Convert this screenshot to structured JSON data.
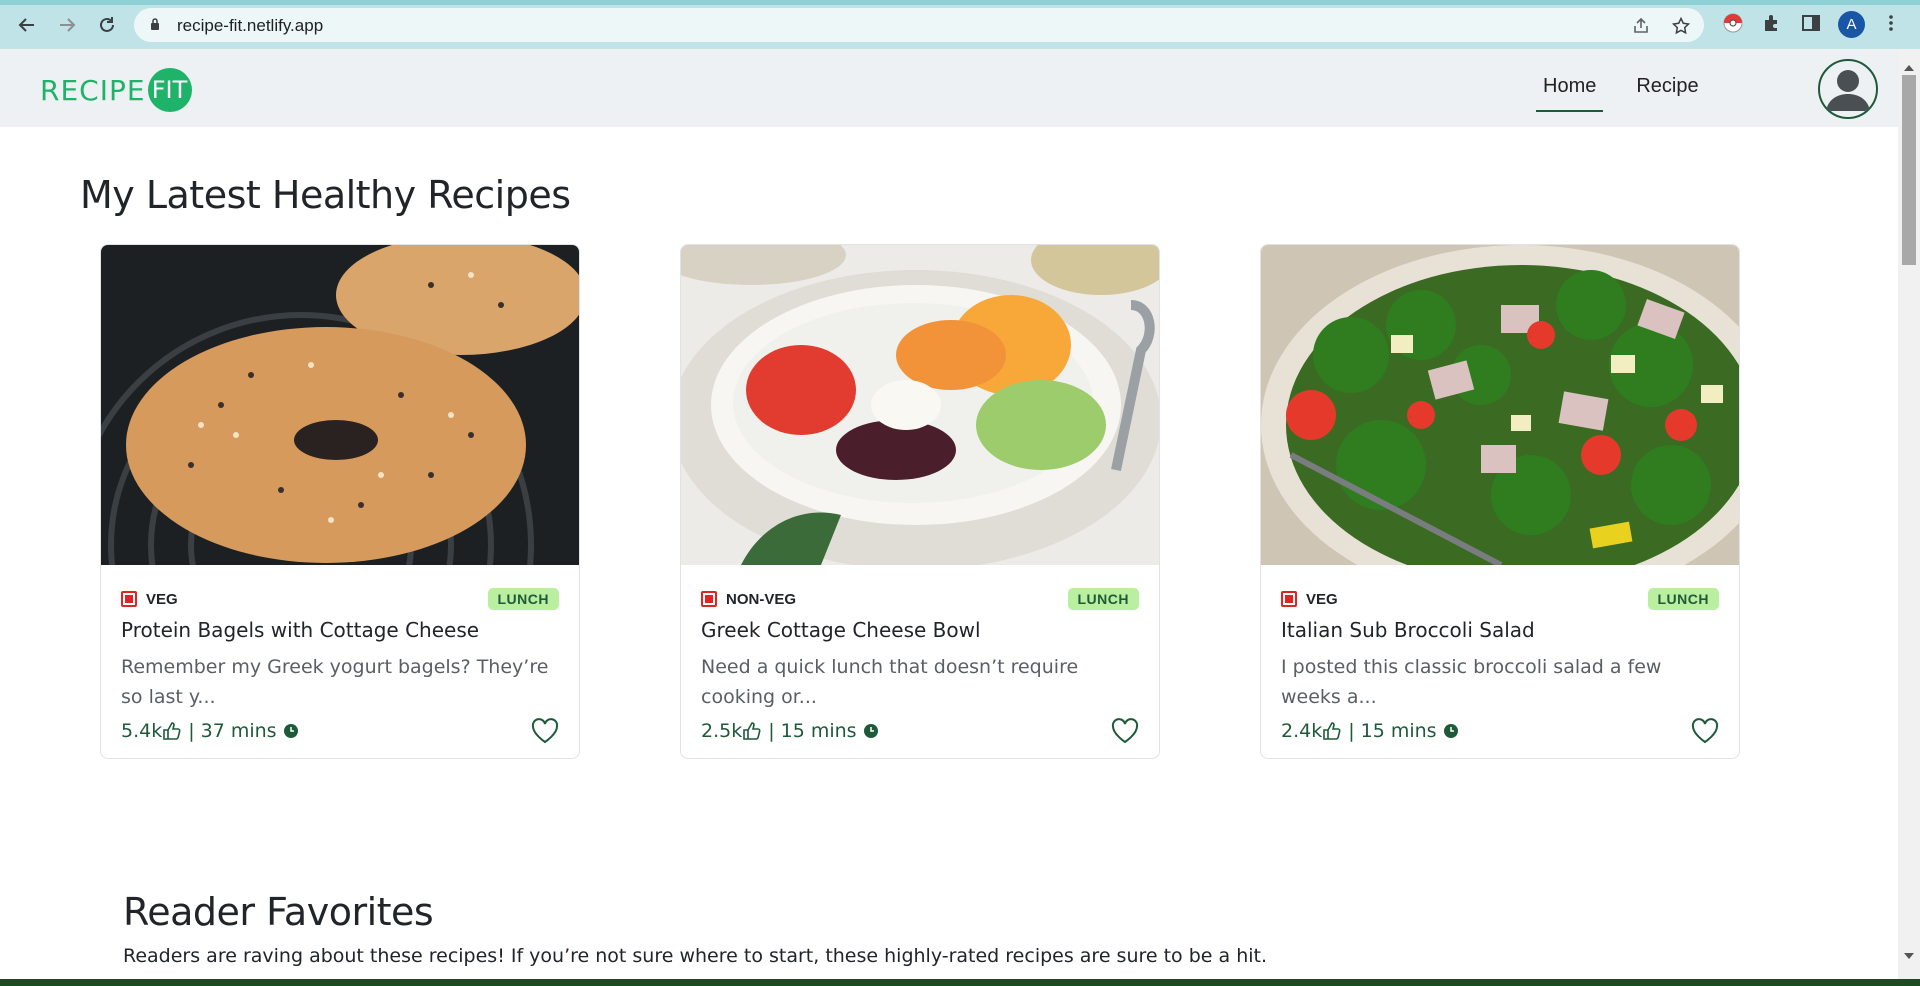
{
  "browser": {
    "url": "recipe-fit.netlify.app",
    "profile_initial": "A"
  },
  "site": {
    "logo_text": "RECIPE",
    "logo_badge": "FIT",
    "nav": [
      {
        "label": "Home",
        "active": true
      },
      {
        "label": "Recipe",
        "active": false
      }
    ]
  },
  "latest": {
    "title": "My Latest Healthy Recipes",
    "cards": [
      {
        "diet": "VEG",
        "category": "LUNCH",
        "title": "Protein Bagels with Cottage Cheese",
        "description": "Remember my Greek yogurt bagels? They’re so last y...",
        "likes": "5.4k",
        "time": "37 mins",
        "image": "bagel"
      },
      {
        "diet": "NON-VEG",
        "category": "LUNCH",
        "title": "Greek Cottage Cheese Bowl",
        "description": "Need a quick lunch that doesn’t require cooking or...",
        "likes": "2.5k",
        "time": "15 mins",
        "image": "greek-bowl"
      },
      {
        "diet": "VEG",
        "category": "LUNCH",
        "title": "Italian Sub Broccoli Salad",
        "description": "I posted this classic broccoli salad a few weeks a...",
        "likes": "2.4k",
        "time": "15 mins",
        "image": "broccoli-salad"
      }
    ]
  },
  "favorites": {
    "title": "Reader Favorites",
    "subtitle": "Readers are raving about these recipes! If you’re not sure where to start, these highly-rated recipes are sure to be a hit."
  },
  "colors": {
    "brand": "#1fb36a",
    "accent_dark": "#1e5a3a",
    "category_bg": "#b9ef9f",
    "diet_mark": "#e02424"
  }
}
